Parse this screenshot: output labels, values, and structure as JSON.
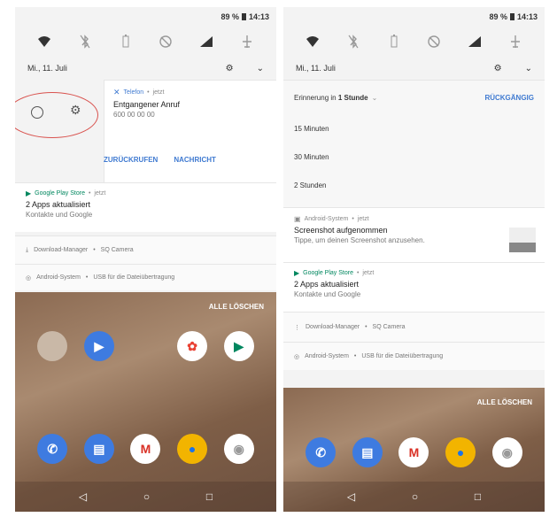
{
  "left": {
    "status": {
      "battery": "89 %",
      "time": "14:13"
    },
    "quick_settings": [
      "wifi-icon",
      "bluetooth-off-icon",
      "battery-icon",
      "dnd-icon",
      "signal-icon",
      "airplane-icon"
    ],
    "date": "Mi., 11. Juli",
    "call_notification": {
      "app": "Telefon",
      "time": "jetzt",
      "title": "Entgangener Anruf",
      "number": "600 00 00 00",
      "actions": [
        "ZURÜCKRUFEN",
        "NACHRICHT"
      ]
    },
    "play_notification": {
      "app": "Google Play Store",
      "time": "jetzt",
      "title": "2 Apps aktualisiert",
      "subtitle": "Kontakte und Google"
    },
    "collapsed": [
      {
        "app": "Download-Manager",
        "detail": "SQ Camera"
      },
      {
        "app": "Android-System",
        "detail": "USB für die Dateiübertragung"
      }
    ],
    "clear_all": "ALLE LÖSCHEN"
  },
  "right": {
    "status": {
      "battery": "89 %",
      "time": "14:13"
    },
    "date": "Mi., 11. Juli",
    "snooze": {
      "label": "Erinnerung in",
      "value": "1 Stunde",
      "undo": "RÜCKGÄNGIG",
      "options": [
        "15 Minuten",
        "30 Minuten",
        "2 Stunden"
      ]
    },
    "screenshot_notification": {
      "app": "Android-System",
      "time": "jetzt",
      "title": "Screenshot aufgenommen",
      "subtitle": "Tippe, um deinen Screenshot anzusehen."
    },
    "play_notification": {
      "app": "Google Play Store",
      "time": "jetzt",
      "title": "2 Apps aktualisiert",
      "subtitle": "Kontakte und Google"
    },
    "collapsed": [
      {
        "app": "Download-Manager",
        "detail": "SQ Camera"
      },
      {
        "app": "Android-System",
        "detail": "USB für die Dateiübertragung"
      }
    ],
    "clear_all": "ALLE LÖSCHEN"
  },
  "colors": {
    "accent": "#3f7ad1",
    "play_green": "#01875f",
    "annotation_red": "#d9534f"
  }
}
